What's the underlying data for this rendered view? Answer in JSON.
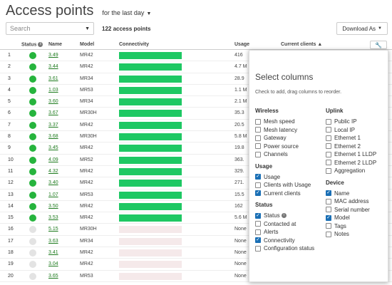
{
  "header": {
    "title": "Access points",
    "period": "for the last day"
  },
  "toolbar": {
    "search_placeholder": "Search",
    "count": "122 access points",
    "download": "Download As"
  },
  "table": {
    "columns": {
      "status": "Status",
      "name": "Name",
      "model": "Model",
      "connectivity": "Connectivity",
      "usage": "Usage",
      "clients": "Current clients",
      "sort_arrow": "▲"
    },
    "rows": [
      {
        "num": "1",
        "online": true,
        "name": "3.49",
        "model": "MR42",
        "usage": "416"
      },
      {
        "num": "2",
        "online": true,
        "name": "3.44",
        "model": "MR42",
        "usage": "4.7 M"
      },
      {
        "num": "3",
        "online": true,
        "name": "3.61",
        "model": "MR34",
        "usage": "28.9"
      },
      {
        "num": "4",
        "online": true,
        "name": "1.03",
        "model": "MR53",
        "usage": "1.1 M"
      },
      {
        "num": "5",
        "online": true,
        "name": "3.60",
        "model": "MR34",
        "usage": "2.1 M"
      },
      {
        "num": "6",
        "online": true,
        "name": "3.67",
        "model": "MR30H",
        "usage": "35.3"
      },
      {
        "num": "7",
        "online": true,
        "name": "3.37",
        "model": "MR42",
        "usage": "20.5"
      },
      {
        "num": "8",
        "online": true,
        "name": "3.68",
        "model": "MR30H",
        "usage": "5.8 M"
      },
      {
        "num": "9",
        "online": true,
        "name": "3.45",
        "model": "MR42",
        "usage": "19.8"
      },
      {
        "num": "10",
        "online": true,
        "name": "4.09",
        "model": "MR52",
        "usage": "363."
      },
      {
        "num": "11",
        "online": true,
        "name": "4.32",
        "model": "MR42",
        "usage": "329."
      },
      {
        "num": "12",
        "online": true,
        "name": "3.40",
        "model": "MR42",
        "usage": "271."
      },
      {
        "num": "13",
        "online": true,
        "name": "1.07",
        "model": "MR53",
        "usage": "15.5"
      },
      {
        "num": "14",
        "online": true,
        "name": "3.50",
        "model": "MR42",
        "usage": "162"
      },
      {
        "num": "15",
        "online": true,
        "name": "3.53",
        "model": "MR42",
        "usage": "5.6 M"
      },
      {
        "num": "16",
        "online": false,
        "name": "5.15",
        "model": "MR30H",
        "usage": "None"
      },
      {
        "num": "17",
        "online": false,
        "name": "3.63",
        "model": "MR34",
        "usage": "None"
      },
      {
        "num": "18",
        "online": false,
        "name": "3.41",
        "model": "MR42",
        "usage": "None"
      },
      {
        "num": "19",
        "online": false,
        "name": "3.04",
        "model": "MR42",
        "usage": "None"
      },
      {
        "num": "20",
        "online": false,
        "name": "3.65",
        "model": "MR53",
        "usage": "None"
      }
    ]
  },
  "panel": {
    "title": "Select columns",
    "subtitle": "Check to add, drag columns to reorder.",
    "left_groups": [
      {
        "title": "Wireless",
        "options": [
          {
            "label": "Mesh speed",
            "checked": false
          },
          {
            "label": "Mesh latency",
            "checked": false
          },
          {
            "label": "Gateway",
            "checked": false
          },
          {
            "label": "Power source",
            "checked": false
          },
          {
            "label": "Channels",
            "checked": false
          }
        ]
      },
      {
        "title": "Usage",
        "options": [
          {
            "label": "Usage",
            "checked": true
          },
          {
            "label": "Clients with Usage",
            "checked": false
          },
          {
            "label": "Current clients",
            "checked": true
          }
        ]
      },
      {
        "title": "Status",
        "options": [
          {
            "label": "Status",
            "checked": true,
            "info": true
          },
          {
            "label": "Contacted at",
            "checked": false
          },
          {
            "label": "Alerts",
            "checked": false
          },
          {
            "label": "Connectivity",
            "checked": true
          },
          {
            "label": "Configuration status",
            "checked": false
          }
        ]
      }
    ],
    "right_groups": [
      {
        "title": "Uplink",
        "options": [
          {
            "label": "Public IP",
            "checked": false
          },
          {
            "label": "Local IP",
            "checked": false
          },
          {
            "label": "Ethernet 1",
            "checked": false
          },
          {
            "label": "Ethernet 2",
            "checked": false
          },
          {
            "label": "Ethernet 1 LLDP",
            "checked": false
          },
          {
            "label": "Ethernet 2 LLDP",
            "checked": false
          },
          {
            "label": "Aggregation",
            "checked": false
          }
        ]
      },
      {
        "title": "Device",
        "options": [
          {
            "label": "Name",
            "checked": true
          },
          {
            "label": "MAC address",
            "checked": false
          },
          {
            "label": "Serial number",
            "checked": false
          },
          {
            "label": "Model",
            "checked": true
          },
          {
            "label": "Tags",
            "checked": false
          },
          {
            "label": "Notes",
            "checked": false
          }
        ]
      }
    ]
  },
  "colors": {
    "online": "#26b43d",
    "offline": "#e3e3e3",
    "bar_good": "#1ec863",
    "bar_none": "#f5e9ea",
    "checked": "#1a6fb5"
  },
  "icons": {
    "caret": "caret-down-icon",
    "wrench": "wrench-icon",
    "info": "info-icon",
    "check": "check-icon"
  }
}
